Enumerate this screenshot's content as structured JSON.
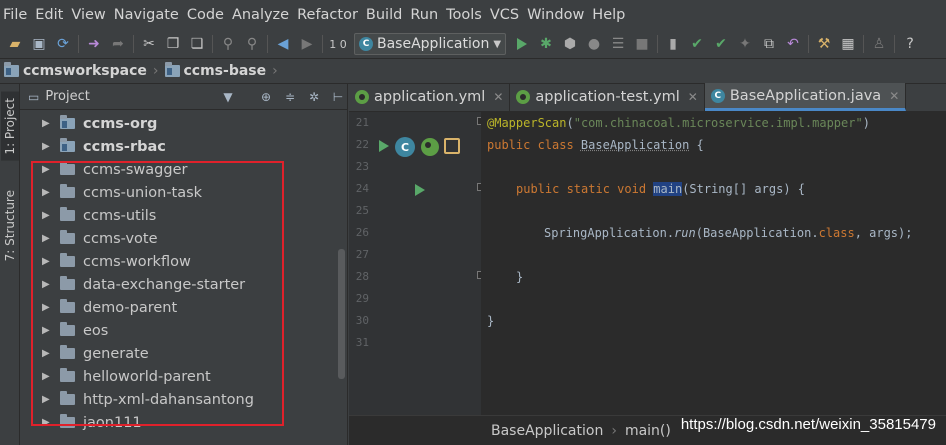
{
  "menu": [
    "File",
    "Edit",
    "View",
    "Navigate",
    "Code",
    "Analyze",
    "Refactor",
    "Build",
    "Run",
    "Tools",
    "VCS",
    "Window",
    "Help"
  ],
  "toolbar": {
    "run_config": "BaseApplication",
    "icons": [
      "open-icon",
      "save-icon",
      "sync-icon",
      "back-icon",
      "forward-icon",
      "cut-icon",
      "copy-icon",
      "paste-icon",
      "find-icon",
      "replace-icon",
      "nav-back-icon",
      "nav-forward-icon",
      "build-icon",
      "run-icon",
      "debug-icon",
      "coverage-icon",
      "profile-icon",
      "stop-icon",
      "vcs-icon",
      "search-icon"
    ]
  },
  "breadcrumb": [
    "ccmsworkspace",
    "ccms-base"
  ],
  "sidebar_tabs": [
    "1: Project",
    "7: Structure"
  ],
  "project_panel": {
    "title": "Project",
    "items": [
      {
        "label": "ccms-org",
        "bold": true,
        "module": true
      },
      {
        "label": "ccms-rbac",
        "bold": true,
        "module": true
      },
      {
        "label": "ccms-swagger",
        "bold": false,
        "module": false
      },
      {
        "label": "ccms-union-task",
        "bold": false,
        "module": false
      },
      {
        "label": "ccms-utils",
        "bold": false,
        "module": false
      },
      {
        "label": "ccms-vote",
        "bold": false,
        "module": false
      },
      {
        "label": "ccms-workflow",
        "bold": false,
        "module": false
      },
      {
        "label": "data-exchange-starter",
        "bold": false,
        "module": false
      },
      {
        "label": "demo-parent",
        "bold": false,
        "module": false
      },
      {
        "label": "eos",
        "bold": false,
        "module": false
      },
      {
        "label": "generate",
        "bold": false,
        "module": false
      },
      {
        "label": "helloworld-parent",
        "bold": false,
        "module": false
      },
      {
        "label": "http-xml-dahansantong",
        "bold": false,
        "module": false
      },
      {
        "label": "jaon111",
        "bold": false,
        "module": false
      }
    ]
  },
  "editor": {
    "tabs": [
      {
        "label": "application.yml",
        "icon": "spring-leaf-icon",
        "active": false
      },
      {
        "label": "application-test.yml",
        "icon": "spring-leaf-icon",
        "active": false
      },
      {
        "label": "BaseApplication.java",
        "icon": "class-icon",
        "active": true
      }
    ],
    "line_numbers": [
      "21",
      "22",
      "23",
      "24",
      "25",
      "26",
      "27",
      "28",
      "29",
      "30",
      "31"
    ],
    "code": {
      "l21_ann": "@MapperScan",
      "l21_open": "(",
      "l21_str": "\"com.chinacoal.microservice.impl.mapper\"",
      "l21_close": ")",
      "l22_kw": "public class ",
      "l22_name": "BaseApplication",
      "l22_rest": " {",
      "l24_kw": "public static void ",
      "l24_main": "main",
      "l24_rest": "(String[] args) {",
      "l26_a": "SpringApplication.",
      "l26_run": "run",
      "l26_b": "(BaseApplication.",
      "l26_cls": "class",
      "l26_c": ", args);",
      "l28": "}",
      "l30": "}"
    },
    "status_breadcrumb": [
      "BaseApplication",
      "main()"
    ]
  },
  "watermark": "https://blog.csdn.net/weixin_35815479",
  "colors": {
    "highlight_box": "#e0212b",
    "accent": "#4a88c7",
    "run_green": "#59a869"
  }
}
